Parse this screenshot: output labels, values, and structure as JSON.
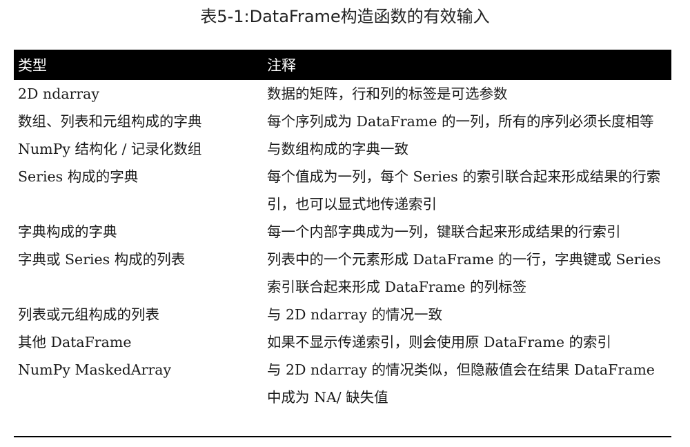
{
  "caption": "表5-1:DataFrame构造函数的有效输入",
  "table": {
    "headers": [
      "类型",
      "注释"
    ],
    "rows": [
      {
        "type": "2D ndarray",
        "note": "数据的矩阵，行和列的标签是可选参数"
      },
      {
        "type": "数组、列表和元组构成的字典",
        "note": "每个序列成为 DataFrame 的一列，所有的序列必须长度相等"
      },
      {
        "type": "NumPy 结构化 / 记录化数组",
        "note": "与数组构成的字典一致"
      },
      {
        "type": "Series 构成的字典",
        "note": "每个值成为一列，每个 Series 的索引联合起来形成结果的行索引，也可以显式地传递索引"
      },
      {
        "type": "字典构成的字典",
        "note": "每一个内部字典成为一列，键联合起来形成结果的行索引"
      },
      {
        "type": "字典或 Series 构成的列表",
        "note": "列表中的一个元素形成 DataFrame 的一行，字典键或 Series 索引联合起来形成 DataFrame 的列标签"
      },
      {
        "type": "列表或元组构成的列表",
        "note": "与 2D ndarray 的情况一致"
      },
      {
        "type": "其他 DataFrame",
        "note": "如果不显示传递索引，则会使用原 DataFrame 的索引"
      },
      {
        "type": "NumPy MaskedArray",
        "note": "与 2D ndarray 的情况类似，但隐蔽值会在结果 DataFrame 中成为 NA/ 缺失值"
      }
    ]
  }
}
